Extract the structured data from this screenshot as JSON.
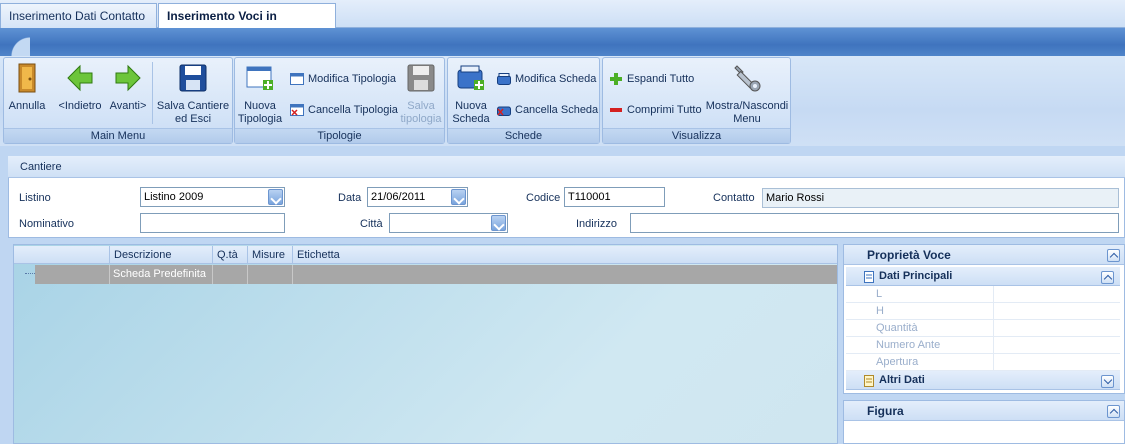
{
  "tabs": [
    {
      "label": "Inserimento Dati Contatto",
      "active": false
    },
    {
      "label": "Inserimento Voci in Cantiere",
      "active": true
    }
  ],
  "ribbon": {
    "main_menu": {
      "label": "Main Menu",
      "annulla": "Annulla",
      "indietro": "<Indietro",
      "avanti": "Avanti>",
      "salva_cantiere": "Salva Cantiere\ned Esci"
    },
    "tipologie": {
      "label": "Tipologie",
      "nuova": "Nuova\nTipologia",
      "modifica": "Modifica Tipologia",
      "cancella": "Cancella Tipologia",
      "salva": "Salva\ntipologia"
    },
    "schede": {
      "label": "Schede",
      "nuova": "Nuova\nScheda",
      "modifica": "Modifica Scheda",
      "cancella": "Cancella Scheda"
    },
    "visualizza": {
      "label": "Visualizza",
      "espandi": "Espandi Tutto",
      "comprimi": "Comprimi Tutto",
      "mostra": "Mostra/Nascondi\nMenu"
    }
  },
  "cantiere": {
    "title": "Cantiere",
    "listino_label": "Listino",
    "listino_value": "Listino 2009",
    "data_label": "Data",
    "data_value": "21/06/2011",
    "codice_label": "Codice",
    "codice_value": "T110001",
    "contatto_label": "Contatto",
    "contatto_value": "Mario Rossi",
    "nominativo_label": "Nominativo",
    "nominativo_value": "",
    "citta_label": "Città",
    "citta_value": "",
    "indirizzo_label": "Indirizzo",
    "indirizzo_value": ""
  },
  "grid": {
    "columns": [
      "Descrizione",
      "Q.tà",
      "Misure",
      "Etichetta"
    ],
    "rows": [
      {
        "descrizione": "Scheda Predefinita",
        "qta": "",
        "misure": "",
        "etichetta": ""
      }
    ]
  },
  "properties": {
    "title": "Proprietà Voce",
    "dati_principali": "Dati Principali",
    "fields": [
      "L",
      "H",
      "Quantità",
      "Numero Ante",
      "Apertura"
    ],
    "altri_dati": "Altri Dati"
  },
  "figura": {
    "title": "Figura"
  },
  "colors": {
    "accent": "#3f74be",
    "selected_row": "#a7a7a7",
    "panel_border": "#9ebbe2"
  }
}
